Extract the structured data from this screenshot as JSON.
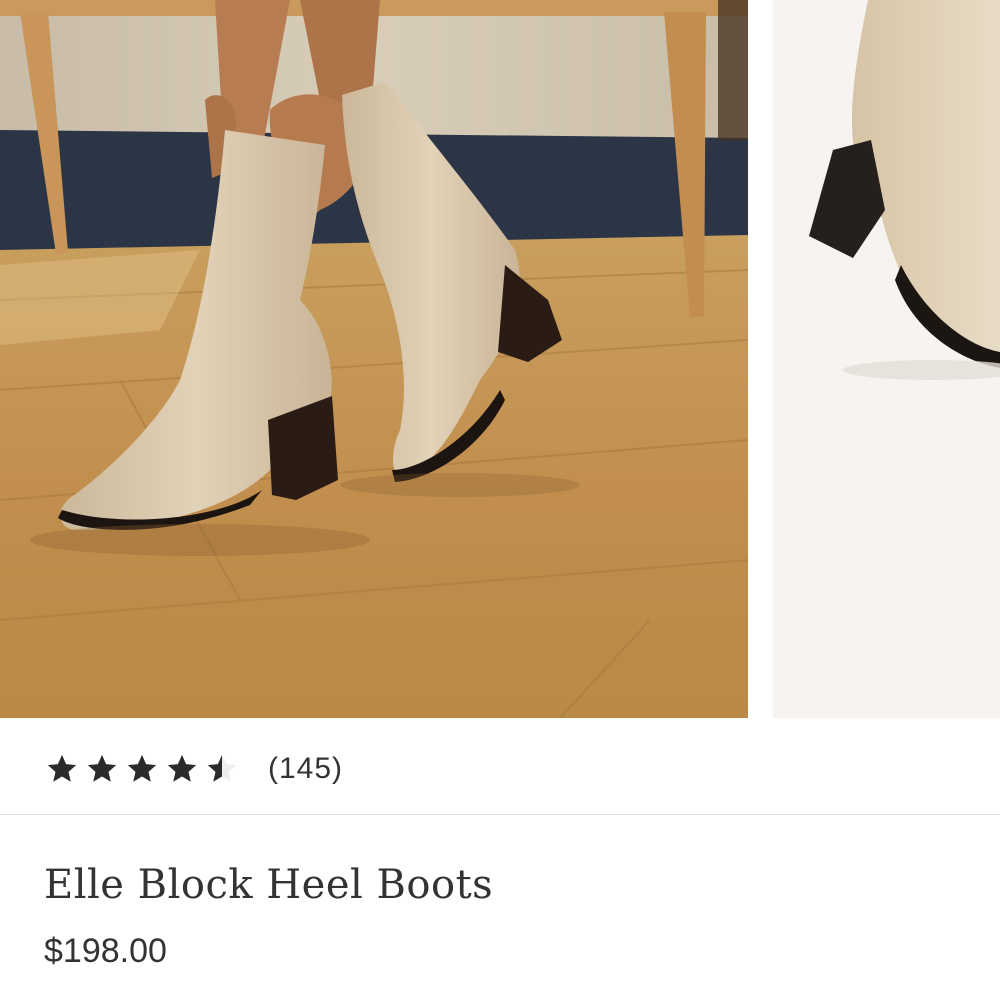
{
  "product": {
    "title": "Elle Block Heel Boots",
    "price": "$198.00",
    "rating": 4.5,
    "rating_max": 5,
    "review_count": "(145)"
  },
  "gallery": {
    "images": [
      {
        "name": "lifestyle-photo",
        "description_icon": "boots-on-wood-floor"
      },
      {
        "name": "product-photo",
        "description_icon": "boot-side-view"
      }
    ]
  },
  "colors": {
    "text": "#333333",
    "star": "#2b2b2b",
    "boot": "#d9c7aa",
    "floor": "#c79a58",
    "divider": "#e3e3e3"
  }
}
